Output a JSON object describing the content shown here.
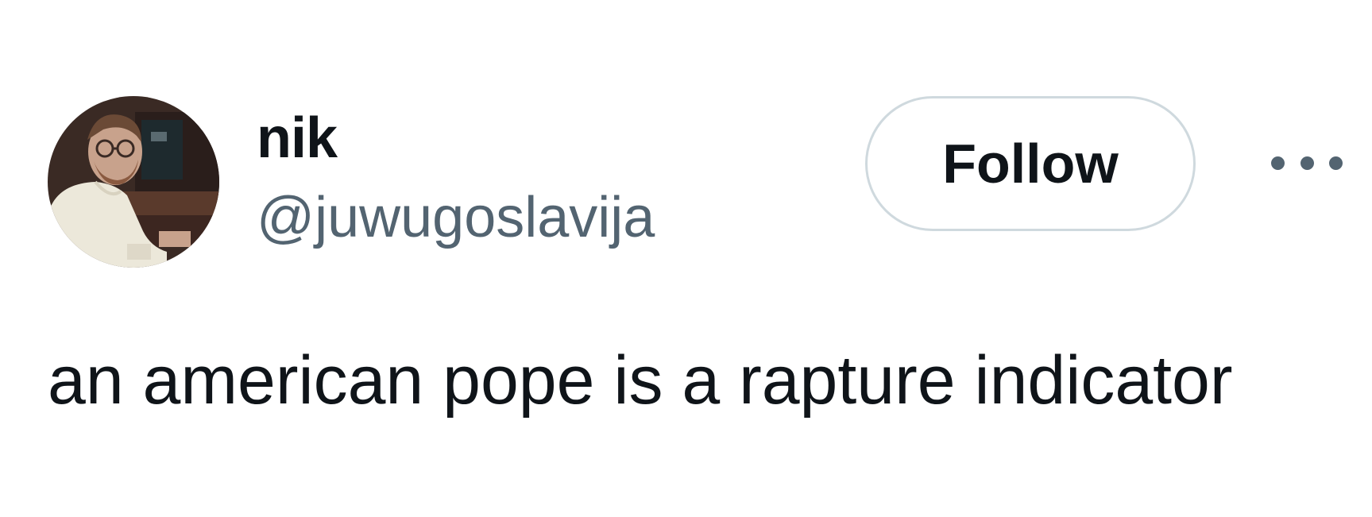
{
  "author": {
    "display_name": "nik",
    "handle": "@juwugoslavija",
    "avatar": "profile-photo"
  },
  "actions": {
    "follow_label": "Follow",
    "more_icon": "more-horizontal-icon"
  },
  "tweet": {
    "text": "an american pope is a rapture indicator"
  },
  "colors": {
    "text_primary": "#0f1419",
    "text_secondary": "#536471",
    "button_border": "#cfd9de",
    "background": "#ffffff"
  }
}
